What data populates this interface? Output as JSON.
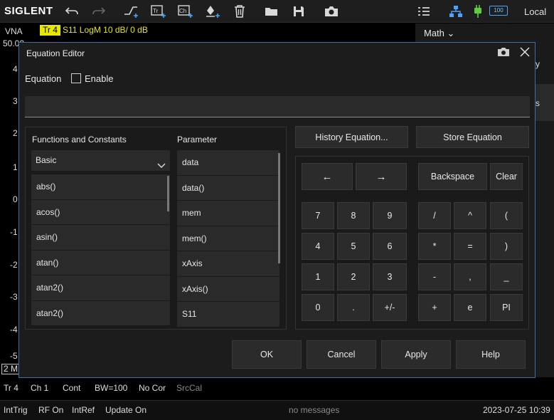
{
  "app": {
    "logo": "SIGLENT",
    "connection": "Local",
    "battery_text": "100"
  },
  "vna": {
    "label": "VNA",
    "trace_badge": "Tr 4",
    "trace_info": "S11  LogM  10 dB/  0 dB",
    "y_ticks": [
      "50.00",
      "4",
      "3",
      "2",
      "1",
      "0",
      "-1",
      "-2",
      "-3",
      "-4",
      "-5"
    ],
    "bottom_marker": "2 M"
  },
  "right_panel": {
    "menu_label": "Math",
    "partial_1": "y",
    "partial_2": "s"
  },
  "status_bar_1": [
    "Tr 4",
    "Ch 1",
    "Cont",
    "BW=100",
    "No Cor",
    "SrcCal"
  ],
  "status_bar_2": {
    "items": [
      "IntTrig",
      "RF On",
      "IntRef",
      "Update On"
    ],
    "message": "no messages",
    "datetime": "2023-07-25 10:39"
  },
  "dialog": {
    "title": "Equation Editor",
    "equation_label": "Equation",
    "enable_label": "Enable",
    "enable_checked": false,
    "equation_value": "",
    "functions_header": "Functions and Constants",
    "parameter_header": "Parameter",
    "category_selected": "Basic",
    "functions": [
      "abs()",
      "acos()",
      "asin()",
      "atan()",
      "atan2()",
      "atan2()"
    ],
    "parameters": [
      "data",
      "data()",
      "mem",
      "mem()",
      "xAxis",
      "xAxis()",
      "S11"
    ],
    "history_button": "History Equation...",
    "store_button": "Store Equation",
    "keys": {
      "left_arrow": "←",
      "right_arrow": "→",
      "backspace": "Backspace",
      "clear": "Clear",
      "k7": "7",
      "k8": "8",
      "k9": "9",
      "div": "/",
      "pow": "^",
      "lparen": "(",
      "k4": "4",
      "k5": "5",
      "k6": "6",
      "mul": "*",
      "eq": "=",
      "rparen": ")",
      "k1": "1",
      "k2": "2",
      "k3": "3",
      "minus": "-",
      "comma": ",",
      "underscore": "_",
      "k0": "0",
      "dot": ".",
      "plusminus": "+/-",
      "plus": "+",
      "e": "e",
      "pi": "PI"
    },
    "ok": "OK",
    "cancel": "Cancel",
    "apply": "Apply",
    "help": "Help"
  }
}
